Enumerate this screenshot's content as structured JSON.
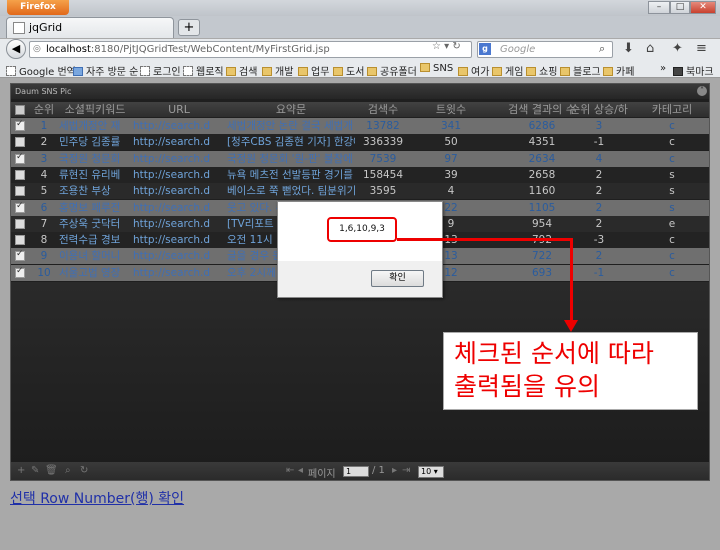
{
  "browser": {
    "app_button": "Firefox",
    "tab_title": "jqGrid",
    "new_tab": "+",
    "url_host": "localhost",
    "url_rest": ":8180/PjtJQGridTest/WebContent/MyFirstGrid.jsp",
    "search_placeholder": "Google",
    "window_min": "–",
    "window_max": "□",
    "window_close": "✕",
    "bookmarks": [
      "Google 번역",
      "자주 방문 순",
      "로그인",
      "웹로직",
      "검색",
      "개발",
      "업무",
      "도서",
      "공유폴더",
      "SNS",
      "여가",
      "게임",
      "쇼핑",
      "블로그",
      "카페"
    ],
    "bookmarks_menu": "북마크"
  },
  "grid": {
    "caption": "Daum SNS Pic",
    "columns": [
      "순위",
      "소셜픽키워드",
      "URL",
      "요약문",
      "검색수",
      "트윗수",
      "검색 결과의 수",
      "순위 상승/하",
      "카테고리"
    ],
    "rows": [
      {
        "selected": true,
        "rank": "1",
        "keyword": "세법개정안 재",
        "url": "http://search.d",
        "summary": "세법개정안 논란 결국 세법개",
        "searches": "13782",
        "tweets": "341",
        "results": "6286",
        "change": "3",
        "category": "c"
      },
      {
        "selected": false,
        "rank": "2",
        "keyword": "민주당 김종률",
        "url": "http://search.d",
        "summary": "[청주CBS 김종현 기자] 한강에",
        "searches": "336339",
        "tweets": "50",
        "results": "4351",
        "change": "-1",
        "category": "c"
      },
      {
        "selected": true,
        "rank": "3",
        "keyword": "국정원 청문회",
        "url": "http://search.d",
        "summary": "국정원 청문회 '원-판' 불참에",
        "searches": "7539",
        "tweets": "97",
        "results": "2634",
        "change": "4",
        "category": "c"
      },
      {
        "selected": false,
        "rank": "4",
        "keyword": "류현진 유리베",
        "url": "http://search.d",
        "summary": "뉴욕 메츠전 선발등판 경기를",
        "searches": "158454",
        "tweets": "39",
        "results": "2658",
        "change": "2",
        "category": "s"
      },
      {
        "selected": false,
        "rank": "5",
        "keyword": "조용찬 부상",
        "url": "http://search.d",
        "summary": "베이스로 쭉 뻗었다. 팀분위기",
        "searches": "3595",
        "tweets": "4",
        "results": "1160",
        "change": "2",
        "category": "s"
      },
      {
        "selected": true,
        "rank": "6",
        "keyword": "홍명보 페루전",
        "url": "http://search.d",
        "summary": "웃고 있다. 수업",
        "searches": "",
        "tweets": "22",
        "results": "1105",
        "change": "2",
        "category": "s"
      },
      {
        "selected": false,
        "rank": "7",
        "keyword": "주상욱 굿닥터",
        "url": "http://search.d",
        "summary": "[TV리포트 = 0",
        "searches": "",
        "tweets": "9",
        "results": "954",
        "change": "2",
        "category": "e"
      },
      {
        "selected": false,
        "rank": "8",
        "keyword": "전력수급 경보",
        "url": "http://search.d",
        "summary": "오전 11시 19분",
        "searches": "",
        "tweets": "13",
        "results": "792",
        "change": "-3",
        "category": "c"
      },
      {
        "selected": true,
        "rank": "9",
        "keyword": "이용녀 할머니",
        "url": "http://search.d",
        "summary": "글을 경우 원숭",
        "searches": "",
        "tweets": "13",
        "results": "722",
        "change": "2",
        "category": "c"
      },
      {
        "selected": true,
        "rank": "10",
        "keyword": "서울고법 영장",
        "url": "http://search.d",
        "summary": "오후 2시께 서울",
        "searches": "",
        "tweets": "12",
        "results": "693",
        "change": "-1",
        "category": "c"
      }
    ],
    "pager": {
      "page_label": "페이지",
      "page_value": "1",
      "of_label": "/ 1",
      "rows_value": "10"
    }
  },
  "link_text": "선택 Row Number(행) 확인",
  "alert": {
    "message": "1,6,10,9,3",
    "ok": "확인"
  },
  "annotation": {
    "line1": "체크된 순서에 따라",
    "line2": "출력됨을 유의",
    "color": "#e00000"
  }
}
